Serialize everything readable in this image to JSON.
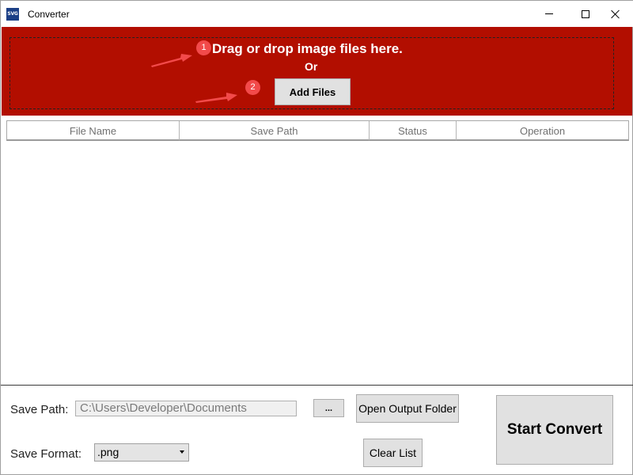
{
  "window": {
    "title": "Converter",
    "icon_label": "SVG",
    "icon": "svg-app-icon"
  },
  "title_buttons": {
    "minimize": "minimize-icon",
    "maximize": "maximize-icon",
    "close": "close-icon"
  },
  "drop_zone": {
    "title": "Drag or drop image files here.",
    "or": "Or",
    "add_files_label": "Add Files",
    "background_color": "#b20e00",
    "steps": [
      {
        "number": "1"
      },
      {
        "number": "2"
      }
    ]
  },
  "table": {
    "columns": [
      "File Name",
      "Save Path",
      "Status",
      "Operation"
    ],
    "rows": []
  },
  "controls": {
    "save_path_label": "Save Path:",
    "save_path_value": "C:\\Users\\Developer\\Documents",
    "browse_label": "...",
    "open_folder_label": "Open Output Folder",
    "save_format_label": "Save Format:",
    "save_format_value": ".png",
    "clear_list_label": "Clear List",
    "start_convert_label": "Start Convert"
  },
  "colors": {
    "accent_red": "#b20e00",
    "badge_red": "#f24a4a",
    "button_gray": "#e1e1e1"
  }
}
